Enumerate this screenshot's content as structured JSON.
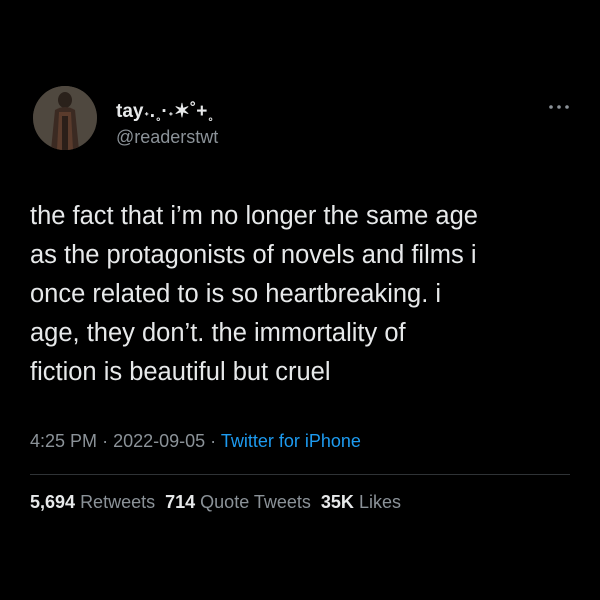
{
  "author": {
    "display_name": "tay˖.˳·˖✶˚+˳",
    "handle": "@readerstwt",
    "avatar": "avatar-photo"
  },
  "more_icon": "more-horizontal-icon",
  "tweet": {
    "lines": [
      "the fact that i’m no longer the same age",
      "as the protagonists of novels and films i",
      "once related to is so heartbreaking. i",
      "age, they don’t. the immortality of",
      "fiction is beautiful but cruel"
    ]
  },
  "meta": {
    "time": "4:25 PM",
    "separator": "·",
    "date": "2022-09-05",
    "source": "Twitter for iPhone"
  },
  "stats": {
    "retweets_count": "5,694",
    "retweets_label": "Retweets",
    "quotes_count": "714",
    "quotes_label": "Quote Tweets",
    "likes_count": "35K",
    "likes_label": "Likes"
  },
  "colors": {
    "background": "#000000",
    "text": "#e7e9ea",
    "secondary": "#8b9298",
    "link": "#1d9bf0",
    "divider": "#2f3336"
  }
}
